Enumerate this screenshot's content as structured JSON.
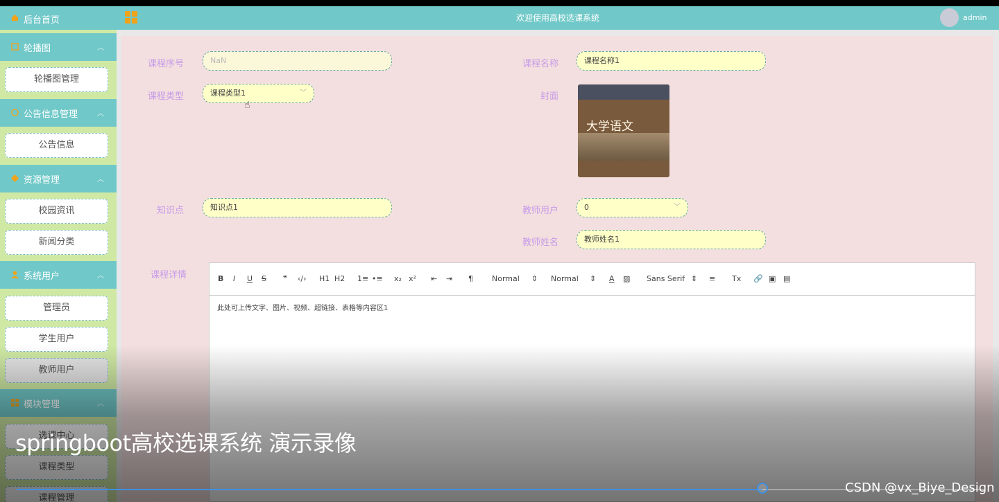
{
  "header": {
    "title": "欢迎使用高校选课系统",
    "user": "admin"
  },
  "sidebar": {
    "home": "后台首页",
    "groups": [
      {
        "label": "轮播图",
        "items": [
          "轮播图管理"
        ]
      },
      {
        "label": "公告信息管理",
        "items": [
          "公告信息"
        ]
      },
      {
        "label": "资源管理",
        "items": [
          "校园资讯",
          "新闻分类"
        ]
      },
      {
        "label": "系统用户",
        "items": [
          "管理员",
          "学生用户",
          "教师用户"
        ]
      },
      {
        "label": "模块管理",
        "items": [
          "选课中心",
          "课程类型",
          "课程管理"
        ]
      }
    ]
  },
  "form": {
    "course_no_label": "课程序号",
    "course_no_value": "NaN",
    "course_name_label": "课程名称",
    "course_name_value": "课程名称1",
    "course_type_label": "课程类型",
    "course_type_value": "课程类型1",
    "cover_label": "封面",
    "cover_title": "大学语文",
    "knowledge_label": "知识点",
    "knowledge_value": "知识点1",
    "teacher_user_label": "教师用户",
    "teacher_user_value": "0",
    "teacher_name_label": "教师姓名",
    "teacher_name_value": "教师姓名1",
    "detail_label": "课程详情"
  },
  "editor": {
    "toolbar": [
      "B",
      "I",
      "U",
      "S",
      "❞",
      "‹/›",
      "H1",
      "H2",
      "1≡",
      "•≡",
      "x₂",
      "x²",
      "⇤",
      "⇥",
      "¶",
      "Normal",
      "Normal",
      "A",
      "▨",
      "Sans Serif",
      "≡",
      "Tx",
      "🔗",
      "▣",
      "▤"
    ],
    "content": "此处可上传文字、图片、视频、超链接、表格等内容区1"
  },
  "video": {
    "caption": "springboot高校选课系统 演示录像",
    "watermark": "CSDN @vx_Biye_Design",
    "progress": 0.771
  }
}
